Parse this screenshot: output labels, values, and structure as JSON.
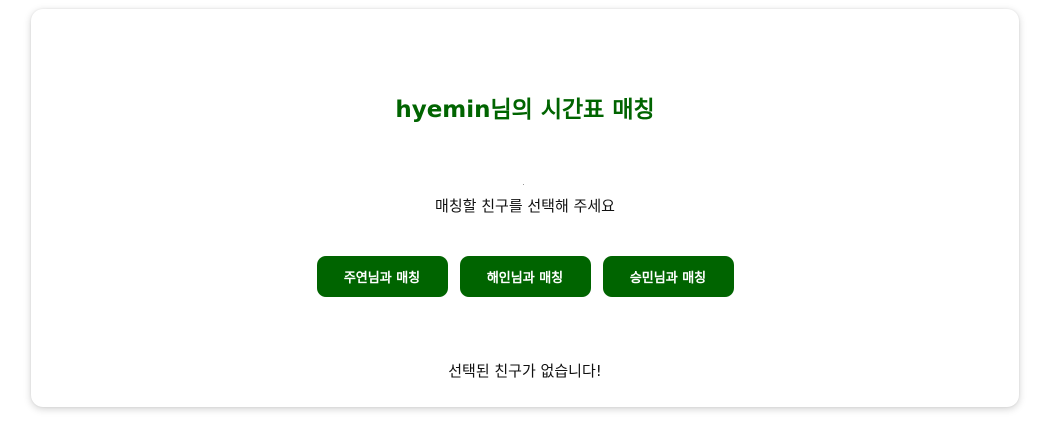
{
  "page": {
    "title": "hyemin님의 시간표 매칭",
    "prompt": "매칭할 친구를 선택해 주세요",
    "status": "선택된 친구가 없습니다!"
  },
  "buttons": [
    {
      "label": "주연님과 매칭"
    },
    {
      "label": "해인님과 매칭"
    },
    {
      "label": "승민님과 매칭"
    }
  ],
  "colors": {
    "accent": "#006400",
    "button_text": "#ffffff"
  }
}
